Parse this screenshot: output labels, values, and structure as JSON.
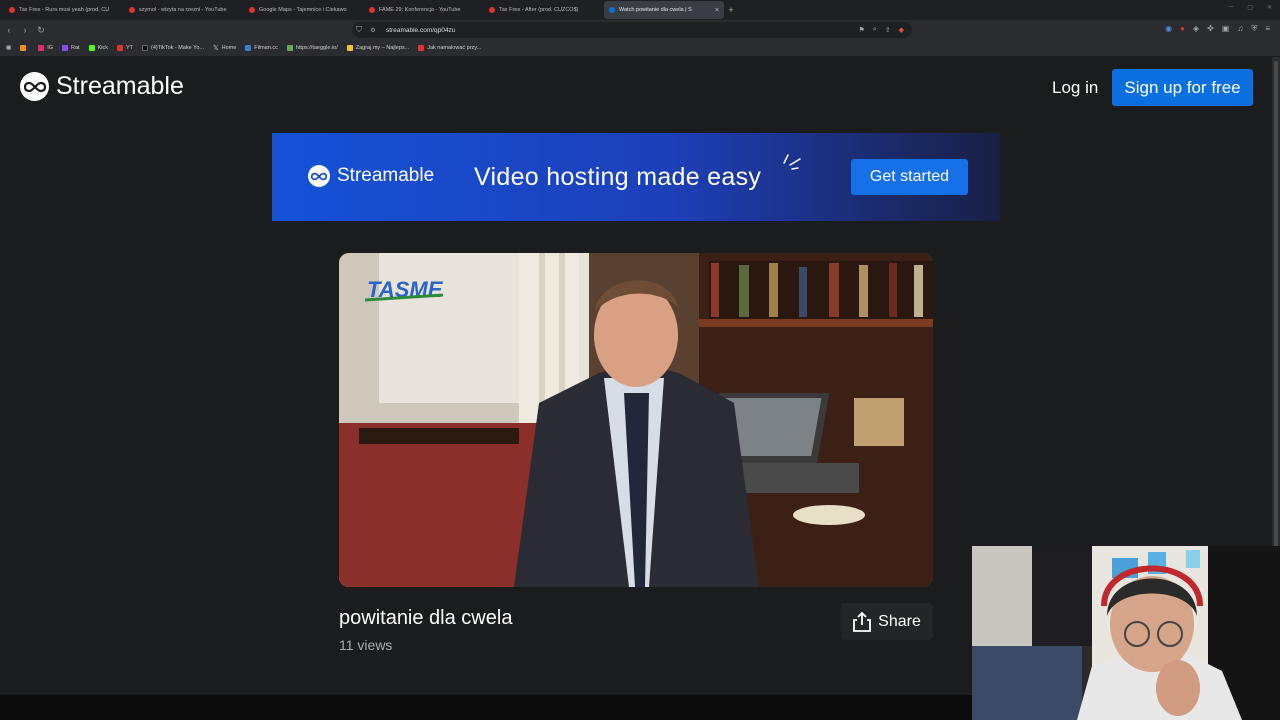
{
  "browser": {
    "tabs": [
      {
        "title": "Tax Free - Rura musi yeah (prod. CU",
        "color": "#e0332c"
      },
      {
        "title": "szymol - wizyta na rzezni - YouTube",
        "color": "#e0332c"
      },
      {
        "title": "Google Maps - Tajemnice i Ciekawo",
        "color": "#e0332c"
      },
      {
        "title": "FAME 29: Konferencja - YouTube",
        "color": "#e0332c"
      },
      {
        "title": "Tax Free - After (prod. CUZCO$)",
        "color": "#e0332c"
      },
      {
        "title": "Watch powitanie dla cwela | S",
        "color": "#0a6fe0",
        "active": true
      }
    ],
    "new_tab": "+",
    "close": "×",
    "url": "streamable.com/qp04zu",
    "bookmarks": [
      {
        "label": "",
        "color": "#f28b20"
      },
      {
        "label": "IG",
        "color": "#d6336c"
      },
      {
        "label": "Rat",
        "color": "#9146ff"
      },
      {
        "label": "Kick",
        "color": "#53fc18"
      },
      {
        "label": "YT",
        "color": "#e0332c"
      },
      {
        "label": "(4)TikTok - Make Yo...",
        "color": "#111111"
      },
      {
        "label": "Home",
        "color": "#ffffff"
      },
      {
        "label": "Filman.cc",
        "color": "#3a7bd5"
      },
      {
        "label": "https://taeggle.io/",
        "color": "#6aa84f"
      },
      {
        "label": "Zagraj.my – Najleps...",
        "color": "#f1c232"
      },
      {
        "label": "Jak namalować przy...",
        "color": "#e0332c"
      }
    ]
  },
  "header": {
    "brand": "Streamable",
    "login_label": "Log in",
    "signup_label": "Sign up for free"
  },
  "banner": {
    "brand": "Streamable",
    "tagline": "Video hosting made easy",
    "cta_label": "Get started"
  },
  "video": {
    "watermark": "TASME",
    "title": "powitanie dla cwela",
    "views": "11 views",
    "share_label": "Share"
  },
  "colors": {
    "accent": "#0a6fe0",
    "page_bg": "#1b1c1e"
  }
}
